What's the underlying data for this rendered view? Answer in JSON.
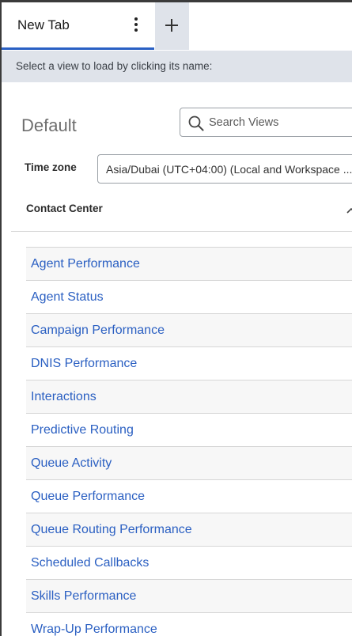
{
  "tabs": {
    "active_label": "New Tab",
    "menu_icon": "kebab-menu-icon",
    "add_icon": "plus-icon"
  },
  "infobar": {
    "text": "Select a view to load by clicking its name:"
  },
  "main": {
    "title": "Default",
    "search": {
      "placeholder": "Search Views",
      "icon": "search-icon"
    },
    "timezone": {
      "label": "Time zone",
      "value": "Asia/Dubai (UTC+04:00) (Local and Workspace ..."
    },
    "section": {
      "title": "Contact Center",
      "icon": "chevron-up-icon",
      "items": [
        {
          "label": "Agent Performance"
        },
        {
          "label": "Agent Status"
        },
        {
          "label": "Campaign Performance"
        },
        {
          "label": "DNIS Performance"
        },
        {
          "label": "Interactions"
        },
        {
          "label": "Predictive Routing"
        },
        {
          "label": "Queue Activity"
        },
        {
          "label": "Queue Performance"
        },
        {
          "label": "Queue Routing Performance"
        },
        {
          "label": "Scheduled Callbacks"
        },
        {
          "label": "Skills Performance"
        },
        {
          "label": "Wrap-Up Performance"
        }
      ]
    }
  },
  "colors": {
    "link": "#2a5fc2",
    "active_tab_underline": "#2a60c4",
    "infobar_bg": "#dfe3ea"
  }
}
